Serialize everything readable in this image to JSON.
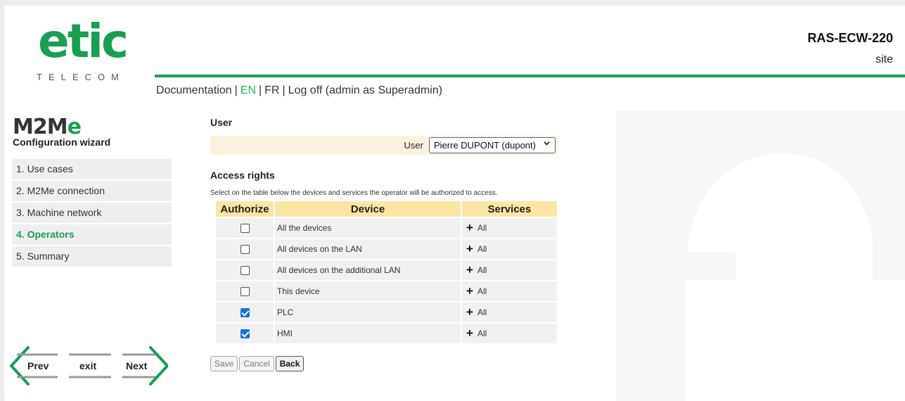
{
  "header": {
    "logo_word": "etic",
    "logo_sub": "TELECOM",
    "device_model": "RAS-ECW-220",
    "device_site": "site"
  },
  "topnav": {
    "documentation": "Documentation",
    "en": "EN",
    "fr": "FR",
    "logoff": "Log off (admin as Superadmin)",
    "separator": "|"
  },
  "wizard": {
    "logo_m2": "M2M",
    "logo_e": "e",
    "subtitle": "Configuration wizard",
    "steps": [
      {
        "label": "1. Use cases",
        "active": false
      },
      {
        "label": "2. M2Me connection",
        "active": false
      },
      {
        "label": "3. Machine network",
        "active": false
      },
      {
        "label": "4. Operators",
        "active": true
      },
      {
        "label": "5. Summary",
        "active": false
      }
    ],
    "prev_label": "Prev",
    "exit_label": "exit",
    "next_label": "Next"
  },
  "main": {
    "user_section_title": "User",
    "user_label": "User",
    "user_selected": "Pierre DUPONT (dupont)",
    "access_title": "Access rights",
    "access_description": "Select on the table below the devices and services the operator will be authorized to access.",
    "table": {
      "headers": [
        "Authorize",
        "Device",
        "Services"
      ],
      "rows": [
        {
          "authorized": false,
          "device": "All the devices",
          "services": "All"
        },
        {
          "authorized": false,
          "device": "All devices on the LAN",
          "services": "All"
        },
        {
          "authorized": false,
          "device": "All devices on the additional LAN",
          "services": "All"
        },
        {
          "authorized": false,
          "device": "This device",
          "services": "All"
        },
        {
          "authorized": true,
          "device": "PLC",
          "services": "All"
        },
        {
          "authorized": true,
          "device": "HMI",
          "services": "All"
        }
      ]
    },
    "buttons": {
      "save": "Save",
      "cancel": "Cancel",
      "back": "Back"
    }
  },
  "colors": {
    "brand_green": "#1a9e52",
    "active_link": "#22b35e",
    "header_row": "#fbe6a4",
    "user_row": "#fdf2dd",
    "checkbox_checked": "#1a6fdb"
  },
  "icons": {
    "select_chevron": "chevron-down-icon",
    "service_expand": "plus-icon",
    "prev": "arrow-left-icon",
    "next": "arrow-right-icon"
  }
}
